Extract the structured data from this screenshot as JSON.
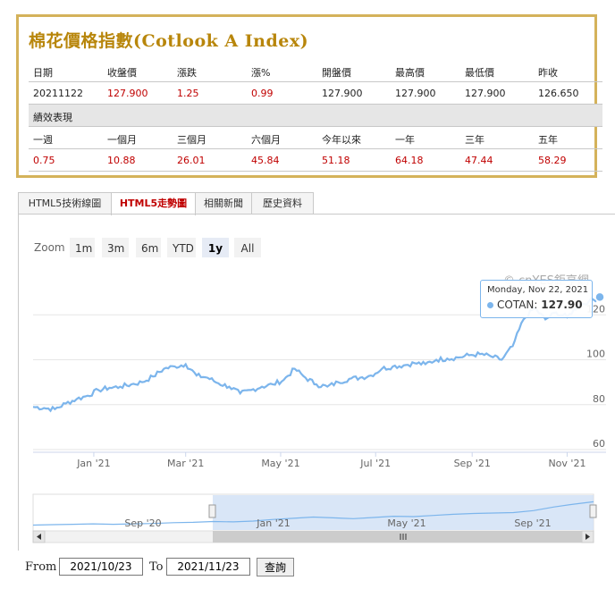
{
  "quote": {
    "title": "棉花價格指數(Cotlook A Index)",
    "headers": [
      "日期",
      "收盤價",
      "漲跌",
      "漲%",
      "開盤價",
      "最高價",
      "最低價",
      "昨收"
    ],
    "values": [
      "20211122",
      "127.900",
      "1.25",
      "0.99",
      "127.900",
      "127.900",
      "127.900",
      "126.650"
    ],
    "section_label": "績效表現",
    "perf_headers": [
      "一週",
      "一個月",
      "三個月",
      "六個月",
      "今年以來",
      "一年",
      "三年",
      "五年"
    ],
    "perf_values": [
      "0.75",
      "10.88",
      "26.01",
      "45.84",
      "51.18",
      "64.18",
      "47.44",
      "58.29"
    ]
  },
  "tabs": [
    {
      "label": "HTML5技術線圖",
      "active": false
    },
    {
      "label": "HTML5走勢圖",
      "active": true
    },
    {
      "label": "相關新聞",
      "active": false
    },
    {
      "label": "歷史資料",
      "active": false
    }
  ],
  "range_selector": {
    "label": "Zoom",
    "buttons": [
      "1m",
      "3m",
      "6m",
      "YTD",
      "1y",
      "All"
    ],
    "selected": "1y"
  },
  "credit": "© cnYES鉅亨網",
  "tooltip": {
    "date": "Monday, Nov 22, 2021",
    "series": "COTAN",
    "value": "127.90"
  },
  "chart_data": {
    "type": "line",
    "series": [
      {
        "name": "COTAN",
        "x": [
          "2020-11-23",
          "2020-11-30",
          "2020-12-07",
          "2020-12-14",
          "2020-12-21",
          "2020-12-28",
          "2021-01-04",
          "2021-01-11",
          "2021-01-18",
          "2021-01-25",
          "2021-02-01",
          "2021-02-08",
          "2021-02-15",
          "2021-02-22",
          "2021-03-01",
          "2021-03-08",
          "2021-03-15",
          "2021-03-22",
          "2021-03-29",
          "2021-04-05",
          "2021-04-12",
          "2021-04-19",
          "2021-04-26",
          "2021-05-03",
          "2021-05-10",
          "2021-05-17",
          "2021-05-24",
          "2021-05-31",
          "2021-06-07",
          "2021-06-14",
          "2021-06-21",
          "2021-06-28",
          "2021-07-05",
          "2021-07-12",
          "2021-07-19",
          "2021-07-26",
          "2021-08-02",
          "2021-08-09",
          "2021-08-16",
          "2021-08-23",
          "2021-08-30",
          "2021-09-06",
          "2021-09-13",
          "2021-09-20",
          "2021-09-27",
          "2021-10-04",
          "2021-10-11",
          "2021-10-18",
          "2021-10-25",
          "2021-11-01",
          "2021-11-08",
          "2021-11-15",
          "2021-11-22"
        ],
        "values": [
          79.0,
          78.5,
          78.0,
          80.5,
          82.5,
          84.0,
          86.5,
          87.5,
          88.0,
          89.0,
          90.0,
          92.5,
          96.0,
          97.0,
          98.0,
          93.0,
          92.0,
          89.5,
          88.0,
          85.0,
          86.5,
          88.0,
          89.0,
          91.0,
          96.0,
          92.0,
          89.0,
          88.0,
          90.0,
          91.5,
          92.0,
          93.0,
          96.0,
          97.0,
          97.5,
          98.5,
          98.0,
          100.0,
          100.5,
          101.0,
          102.0,
          102.5,
          101.5,
          100.0,
          106.0,
          118.0,
          123.0,
          118.0,
          121.0,
          119.0,
          124.0,
          126.0,
          127.9
        ]
      }
    ],
    "x_tick_labels": [
      "Jan '21",
      "Mar '21",
      "May '21",
      "Jul '21",
      "Sep '21",
      "Nov '21"
    ],
    "y_tick_labels": [
      "60",
      "80",
      "100",
      "120"
    ],
    "ylim": [
      60,
      140
    ],
    "navigator_tick_labels": [
      "Sep '20",
      "Jan '21",
      "May '21",
      "Sep '21"
    ],
    "navigator_values": [
      70,
      71,
      72,
      73,
      72,
      73,
      74,
      76,
      77,
      79,
      78,
      80,
      84,
      87,
      90,
      88,
      86,
      89,
      92,
      91,
      94,
      97,
      99,
      100,
      101,
      106,
      115,
      122,
      127.9
    ],
    "grid": true
  },
  "date_range": {
    "from_label": "From",
    "from_value": "2021/10/23",
    "to_label": "To",
    "to_value": "2021/11/23",
    "query_label": "查詢"
  },
  "colors": {
    "line": "#7cb5ec",
    "title": "#b8860b",
    "border": "#d4b25a",
    "positive": "#c00000",
    "navigator_mask": "#cfe0f5"
  }
}
